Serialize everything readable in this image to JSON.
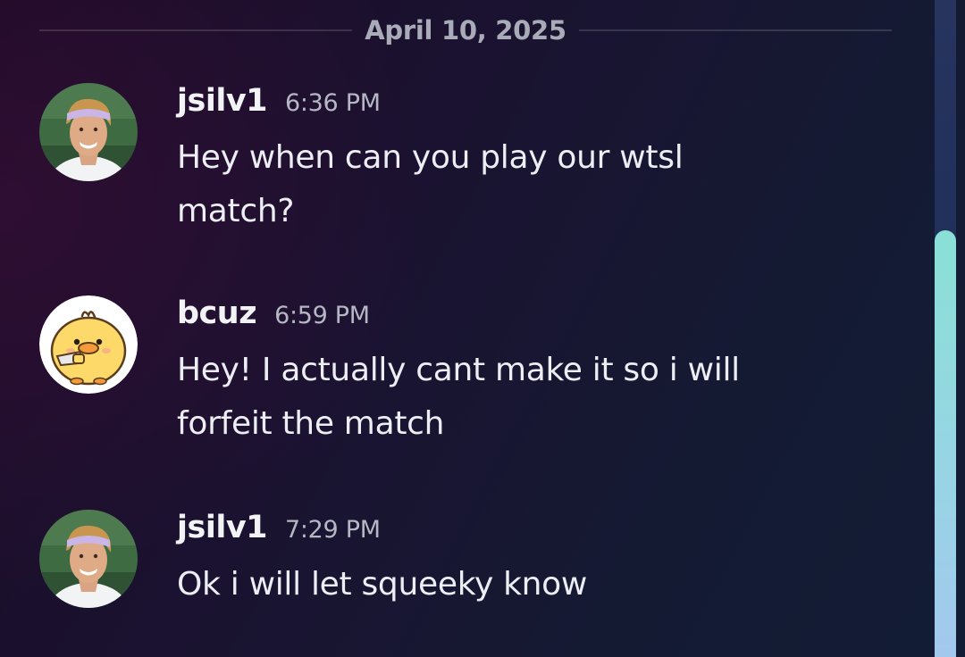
{
  "date_divider": "April 10, 2025",
  "messages": [
    {
      "username": "jsilv1",
      "time": "6:36 PM",
      "text": "Hey when can you play our wtsl match?",
      "avatar": "tennis-player-photo"
    },
    {
      "username": "bcuz",
      "time": "6:59 PM",
      "text": "Hey! I actually cant make it so i will forfeit the match",
      "avatar": "yellow-duck-with-knife"
    },
    {
      "username": "jsilv1",
      "time": "7:29 PM",
      "text": "Ok i will let squeeky know",
      "avatar": "tennis-player-photo"
    }
  ],
  "colors": {
    "scrollbar_thumb": "#8ae0d6",
    "scrollbar_track": "#22315a",
    "background": "#1a1230"
  }
}
